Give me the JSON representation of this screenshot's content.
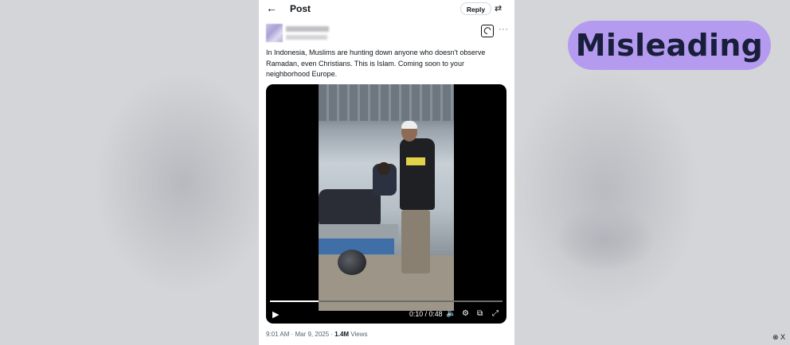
{
  "header": {
    "back_icon": "←",
    "title": "Post",
    "reply_label": "Reply",
    "settings_icon": "⇄"
  },
  "author": {
    "name": "",
    "handle": ""
  },
  "tweet": {
    "text": "In Indonesia, Muslims are hunting down anyone who doesn't observe Ramadan, even Christians. This is Islam. Coming soon to your neighborhood Europe.",
    "more_icon": "···"
  },
  "video": {
    "time": "0:10 / 0:48",
    "progress": 0.21,
    "play_icon": "▶",
    "volume_icon": "🔈",
    "settings_icon": "⚙",
    "pip_icon": "⧉",
    "fullscreen_icon": "⤢"
  },
  "meta": {
    "time": "9:01 AM",
    "date": "Mar 9, 2025",
    "views_count": "1.4M",
    "views_label": "Views"
  },
  "overlay": {
    "label": "Misleading",
    "color": "#b59bf0"
  },
  "credit": "⊗ X"
}
